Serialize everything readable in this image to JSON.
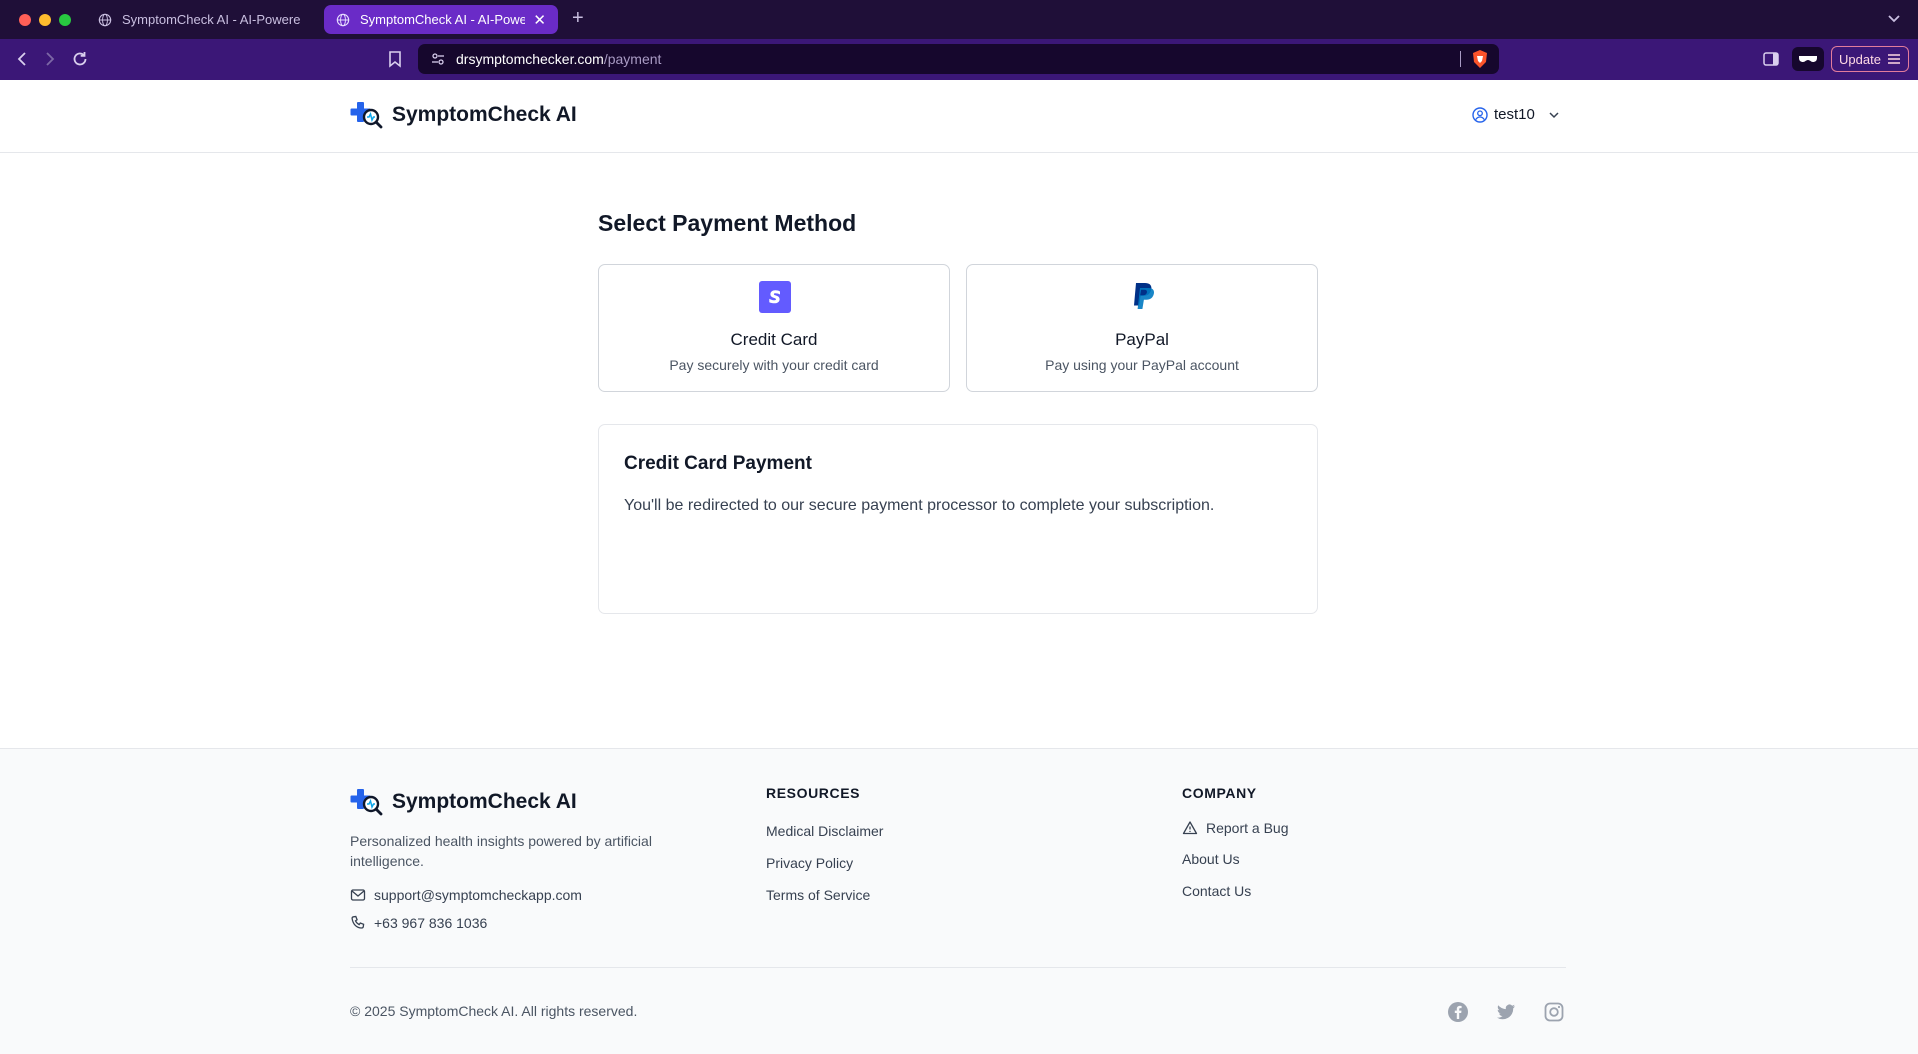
{
  "browser": {
    "tabs": [
      {
        "title": "SymptomCheck AI - AI-Powered",
        "active": false
      },
      {
        "title": "SymptomCheck AI - AI-Powe",
        "active": true
      }
    ],
    "url_host": "drsymptomchecker.com",
    "url_path": "/payment",
    "update_label": "Update"
  },
  "header": {
    "brand": "SymptomCheck AI",
    "username": "test10"
  },
  "main": {
    "title": "Select Payment Method",
    "methods": [
      {
        "title": "Credit Card",
        "description": "Pay securely with your credit card",
        "icon": "stripe-icon",
        "color": "#635bff"
      },
      {
        "title": "PayPal",
        "description": "Pay using your PayPal account",
        "icon": "paypal-icon",
        "color": "#003087"
      }
    ],
    "panel": {
      "title": "Credit Card Payment",
      "text": "You'll be redirected to our secure payment processor to complete your subscription."
    }
  },
  "footer": {
    "brand": "SymptomCheck AI",
    "tagline": "Personalized health insights powered by artificial intelligence.",
    "email": "support@symptomcheckapp.com",
    "phone": "+63 967 836 1036",
    "resources": {
      "heading": "RESOURCES",
      "links": [
        "Medical Disclaimer",
        "Privacy Policy",
        "Terms of Service"
      ]
    },
    "company": {
      "heading": "COMPANY",
      "links": [
        "Report a Bug",
        "About Us",
        "Contact Us"
      ]
    },
    "copyright": "© 2025 SymptomCheck AI. All rights reserved.",
    "social": [
      "facebook-icon",
      "twitter-icon",
      "instagram-icon"
    ]
  },
  "colors": {
    "brand_blue": "#2563eb",
    "browser_titlebar": "#1f0f38",
    "browser_toolbar": "#3b1777",
    "active_tab": "#6a2bc7"
  }
}
